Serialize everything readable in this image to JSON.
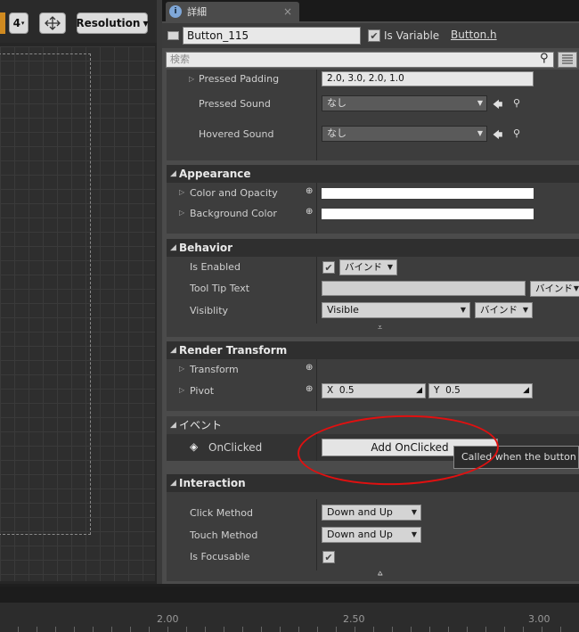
{
  "viewport": {
    "toolbar": {
      "grid_value": "4",
      "resolution_label": "Resolution"
    }
  },
  "details": {
    "tab_title": "詳細",
    "tab_close": "×",
    "name_value": "Button_115",
    "is_variable_label": "Is Variable",
    "is_variable_checked": true,
    "header_link": "Button.h",
    "search_placeholder": "検索"
  },
  "style": {
    "pressed_padding_label": "Pressed Padding",
    "pressed_padding_value": "2.0, 3.0, 2.0, 1.0",
    "pressed_sound_label": "Pressed Sound",
    "pressed_sound_value": "なし",
    "hovered_sound_label": "Hovered Sound",
    "hovered_sound_value": "なし"
  },
  "appearance": {
    "title": "Appearance",
    "color_opacity_label": "Color and Opacity",
    "background_color_label": "Background Color"
  },
  "behavior": {
    "title": "Behavior",
    "is_enabled_label": "Is Enabled",
    "bind_label": "バインド",
    "tooltip_label": "Tool Tip Text",
    "tooltip_bind": "バインド",
    "visibility_label": "Visiblity",
    "visibility_value": "Visible",
    "visibility_bind": "バインド"
  },
  "render_transform": {
    "title": "Render Transform",
    "transform_label": "Transform",
    "pivot_label": "Pivot",
    "pivot_x_label": "X",
    "pivot_x_value": "0.5",
    "pivot_y_label": "Y",
    "pivot_y_value": "0.5"
  },
  "events": {
    "title": "イベント",
    "onclicked_label": "OnClicked",
    "add_button": "Add OnClicked",
    "tooltip": "Called when the button is clicked"
  },
  "interaction": {
    "title": "Interaction",
    "click_method_label": "Click Method",
    "click_method_value": "Down and Up",
    "touch_method_label": "Touch Method",
    "touch_method_value": "Down and Up",
    "is_focusable_label": "Is Focusable",
    "is_focusable_checked": true
  },
  "timeline": {
    "labels": [
      "2.00",
      "2.50",
      "3.00"
    ]
  },
  "annotation_color": "#e01010"
}
